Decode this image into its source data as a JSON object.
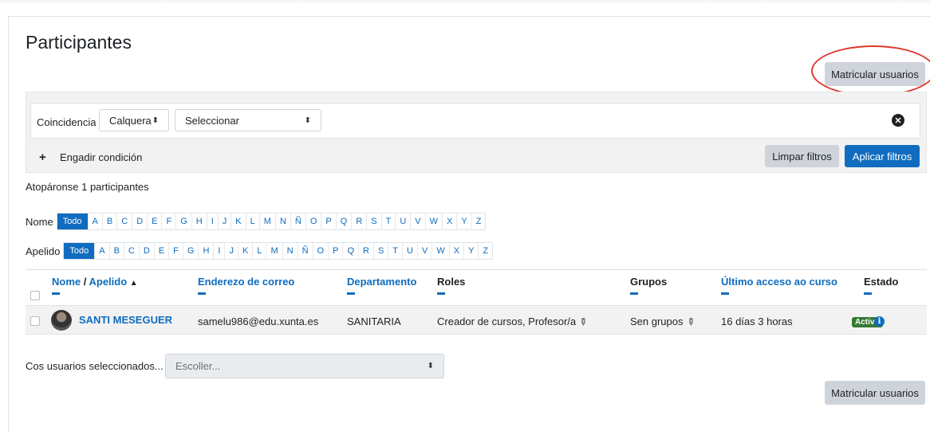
{
  "page": {
    "title": "Participantes",
    "enrol_button": "Matricular usuarios"
  },
  "filters": {
    "match_label": "Coincidencia",
    "match_value": "Calquera",
    "type_value": "Seleccionar",
    "add_condition": "Engadir condición",
    "clear_button": "Limpar filtros",
    "apply_button": "Aplicar filtros"
  },
  "found_text": "Atopáronse 1 participantes",
  "initials": {
    "first_label": "Nome",
    "last_label": "Apelido",
    "all_label": "Todo",
    "letters": [
      "A",
      "B",
      "C",
      "D",
      "E",
      "F",
      "G",
      "H",
      "I",
      "J",
      "K",
      "L",
      "M",
      "N",
      "Ñ",
      "O",
      "P",
      "Q",
      "R",
      "S",
      "T",
      "U",
      "V",
      "W",
      "X",
      "Y",
      "Z"
    ]
  },
  "table": {
    "headers": {
      "name": "Nome",
      "slash": " / ",
      "surname": "Apelido",
      "sort_arrow": "▲",
      "email": "Enderezo de correo",
      "department": "Departamento",
      "roles": "Roles",
      "groups": "Grupos",
      "last_access": "Último acceso ao curso",
      "status": "Estado"
    },
    "row": {
      "name": "SANTI MESEGUER",
      "email": "samelu986@edu.xunta.es",
      "department": "SANITARIA",
      "roles": "Creador de cursos, Profesor/a",
      "groups": "Sen grupos",
      "last_access": "16 días 3 horas",
      "status": "Activo"
    }
  },
  "bulk": {
    "label": "Cos usuarios seleccionados...",
    "placeholder": "Escoller..."
  },
  "colors": {
    "primary": "#0f6cbf",
    "secondary": "#ced4da",
    "success": "#357a32",
    "highlight_circle": "#e03a2f"
  },
  "icons": [
    "plus-icon",
    "close-circle-icon",
    "pencil-icon",
    "info-icon",
    "sort-up-icon",
    "select-caret-icon"
  ]
}
